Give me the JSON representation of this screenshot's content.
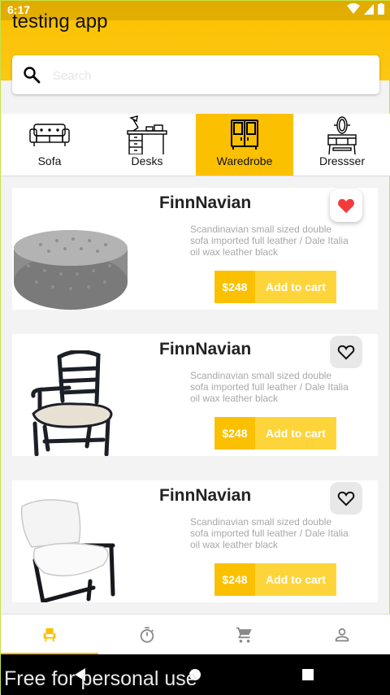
{
  "status_bar": {
    "time": "6:17"
  },
  "app": {
    "title": "testing app"
  },
  "search": {
    "placeholder": "Search"
  },
  "categories": [
    {
      "label": "Sofa",
      "icon": "sofa-icon"
    },
    {
      "label": "Desks",
      "icon": "desk-icon"
    },
    {
      "label": "Waredrobe",
      "icon": "wardrobe-icon",
      "active": true
    },
    {
      "label": "Dressser",
      "icon": "dresser-icon"
    }
  ],
  "products": [
    {
      "name": "FinnNavian",
      "description": "Scandinavian small sized double sofa imported full leather / Dale Italia oil wax leather black",
      "price": "$248",
      "cta": "Add to cart",
      "favorite": true,
      "image": "tufted-ottoman"
    },
    {
      "name": "FinnNavian",
      "description": "Scandinavian small sized double sofa imported full leather / Dale Italia oil wax leather black",
      "price": "$248",
      "cta": "Add to cart",
      "favorite": false,
      "image": "wooden-chair"
    },
    {
      "name": "FinnNavian",
      "description": "Scandinavian small sized double sofa imported full leather / Dale Italia oil wax leather black",
      "price": "$248",
      "cta": "Add to cart",
      "favorite": false,
      "image": "white-armchair"
    }
  ],
  "bottom_nav": [
    {
      "icon": "chair-icon",
      "active": true
    },
    {
      "icon": "timer-icon"
    },
    {
      "icon": "cart-icon"
    },
    {
      "icon": "person-icon"
    }
  ],
  "watermark": "Free for personal use",
  "colors": {
    "accent": "#fbc000",
    "accent_light": "#fdd53a",
    "favorite_red": "#f23b3b"
  }
}
